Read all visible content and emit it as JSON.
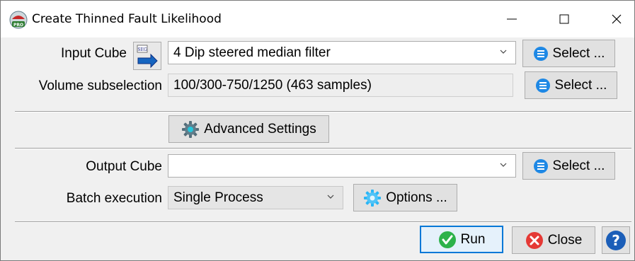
{
  "window": {
    "title": "Create Thinned Fault Likelihood",
    "minimize_symbol": "—",
    "maximize_symbol": "☐",
    "close_symbol": "✕"
  },
  "input": {
    "label": "Input Cube",
    "value": "4 Dip steered median filter",
    "select_label": "Select ..."
  },
  "volume": {
    "label": "Volume subselection",
    "value": "100/300-750/1250 (463 samples)",
    "select_label": "Select ..."
  },
  "advanced": {
    "label": "Advanced Settings"
  },
  "output": {
    "label": "Output Cube",
    "value": "",
    "select_label": "Select ..."
  },
  "batch": {
    "label": "Batch execution",
    "value": "Single Process",
    "options_label": "Options ..."
  },
  "footer": {
    "run_label": "Run",
    "close_label": "Close",
    "help_symbol": "?"
  },
  "colors": {
    "select_icon": "#1e88e5",
    "run_icon": "#2db24a",
    "close_icon": "#e53935",
    "help_bg": "#1b5eb8",
    "default_button_border": "#0078d7"
  }
}
